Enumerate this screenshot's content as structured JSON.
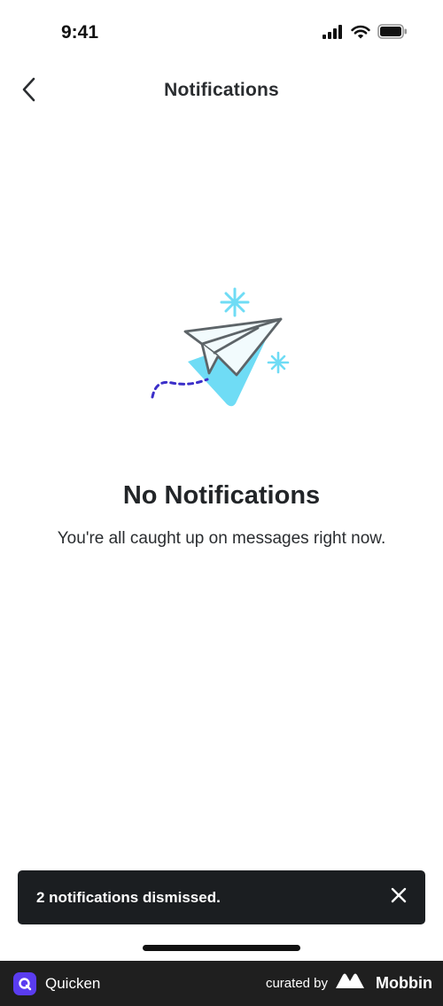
{
  "status_bar": {
    "time": "9:41",
    "icons": [
      "cellular-signal-icon",
      "wifi-icon",
      "battery-icon"
    ]
  },
  "nav": {
    "back_icon": "chevron-left-icon",
    "title": "Notifications"
  },
  "empty_state": {
    "illustration": "paper-plane-illustration",
    "title": "No Notifications",
    "message": "You're all caught up on messages right now."
  },
  "snackbar": {
    "message": "2 notifications dismissed.",
    "close_icon": "close-icon"
  },
  "footer": {
    "app_name": "Quicken",
    "curated_by": "curated by",
    "brand": "Mobbin"
  },
  "colors": {
    "accent_cyan": "#6fdcf5",
    "accent_purple": "#3b2fc9",
    "snackbar_bg": "#1b1e21",
    "footer_bg": "#1f1f1f",
    "logo_purple": "#5a3cf0"
  }
}
